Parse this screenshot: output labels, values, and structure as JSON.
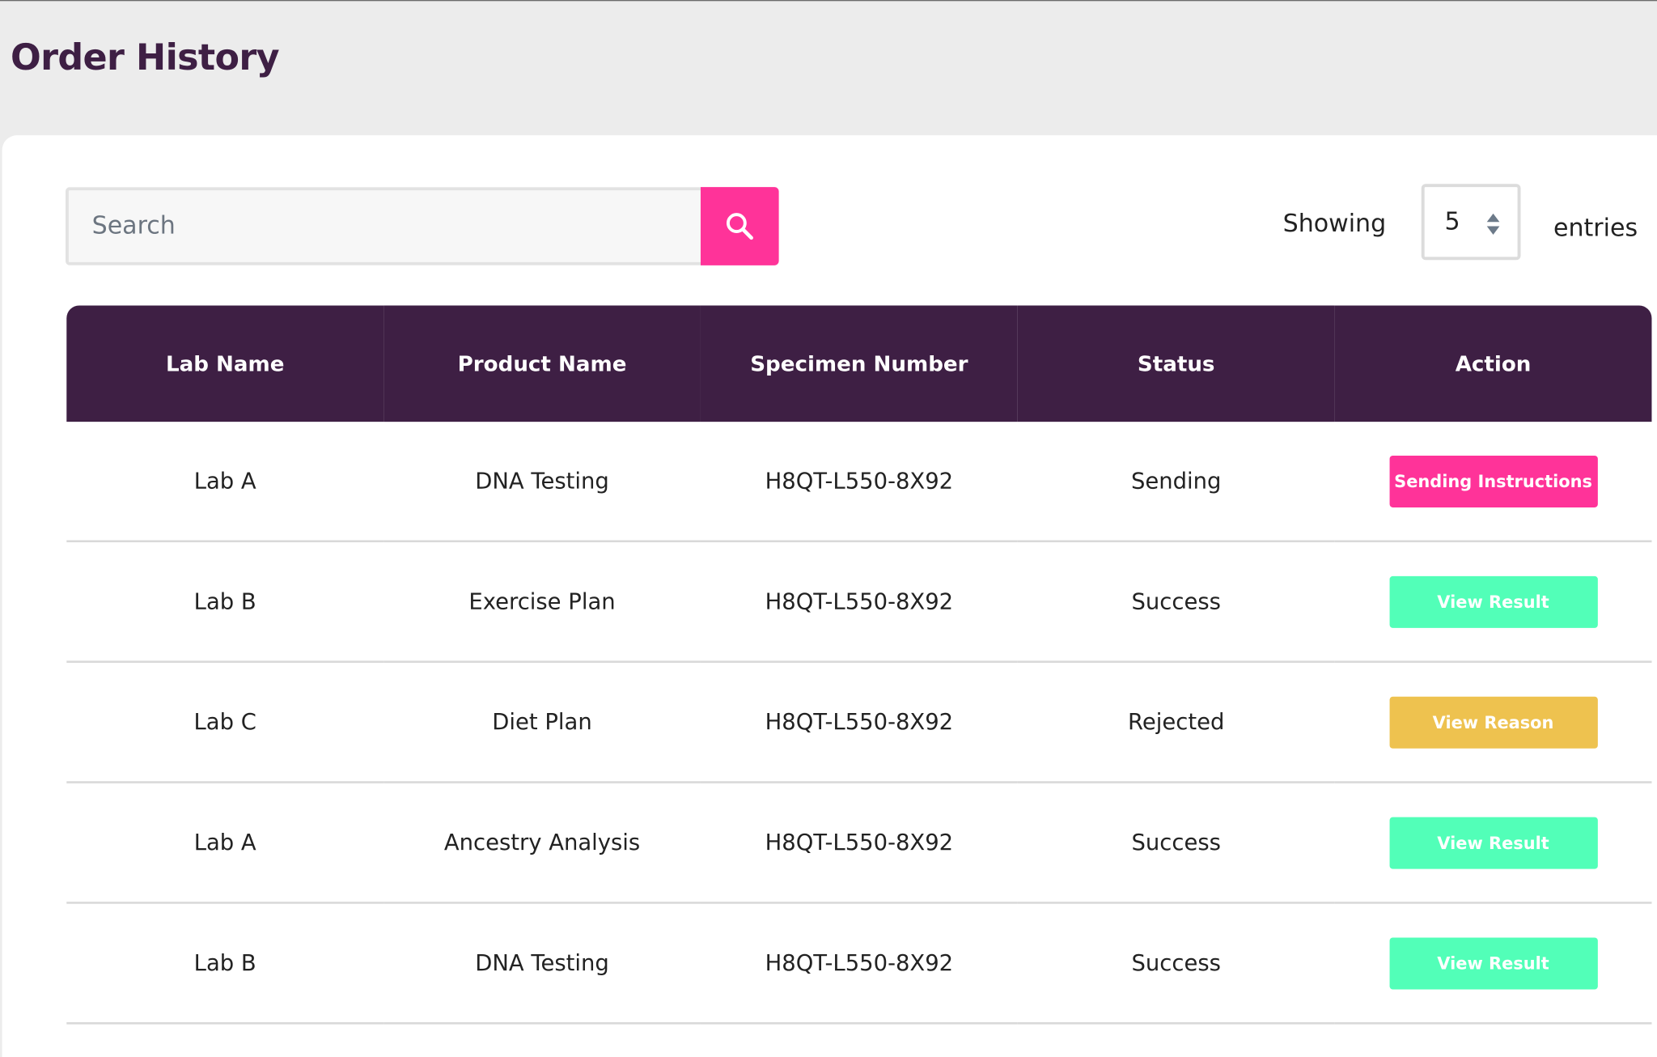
{
  "header": {
    "title": "Order History"
  },
  "search": {
    "placeholder": "Search",
    "value": "",
    "button_icon": "search-icon"
  },
  "entries": {
    "showing_label": "Showing",
    "selected": "5",
    "suffix_label": "entries"
  },
  "colors": {
    "header_bg": "#3e1f44",
    "accent_pink": "#ff3399",
    "success_teal": "#52ffb8",
    "warning_yellow": "#eec24f",
    "page_bg": "#ececec"
  },
  "table": {
    "columns": [
      "Lab Name",
      "Product Name",
      "Specimen Number",
      "Status",
      "Action"
    ],
    "rows": [
      {
        "lab": "Lab A",
        "product": "DNA Testing",
        "specimen": "H8QT-L550-8X92",
        "status": "Sending",
        "action": "Sending Instructions",
        "action_color": "#ff3399"
      },
      {
        "lab": "Lab B",
        "product": "Exercise Plan",
        "specimen": "H8QT-L550-8X92",
        "status": "Success",
        "action": "View Result",
        "action_color": "#52ffb8"
      },
      {
        "lab": "Lab C",
        "product": "Diet Plan",
        "specimen": "H8QT-L550-8X92",
        "status": "Rejected",
        "action": "View Reason",
        "action_color": "#eec24f"
      },
      {
        "lab": "Lab A",
        "product": "Ancestry Analysis",
        "specimen": "H8QT-L550-8X92",
        "status": "Success",
        "action": "View Result",
        "action_color": "#52ffb8"
      },
      {
        "lab": "Lab B",
        "product": "DNA Testing",
        "specimen": "H8QT-L550-8X92",
        "status": "Success",
        "action": "View Result",
        "action_color": "#52ffb8"
      }
    ]
  }
}
